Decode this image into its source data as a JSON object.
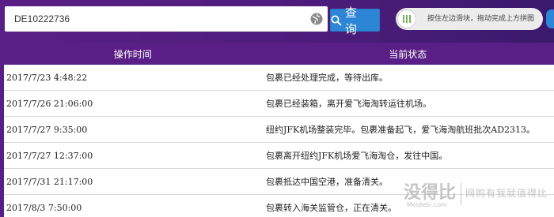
{
  "search": {
    "value": "DE10222736",
    "query_label": "查 询"
  },
  "slider": {
    "hint": "按住左边滑块，拖动完成上方拼图"
  },
  "table": {
    "headers": {
      "time": "操作时间",
      "status": "当前状态"
    },
    "rows": [
      {
        "time": "2017/7/23 4:48:22",
        "status": "包裹已经处理完成，等待出库。"
      },
      {
        "time": "2017/7/26 21:06:00",
        "status": "包裹已经装箱，离开爱飞海淘转运往机场。"
      },
      {
        "time": "2017/7/27 9:35:00",
        "status": "纽约JFK机场整装完毕。包裹准备起飞，爱飞海淘航班批次AD2313。"
      },
      {
        "time": "2017/7/27 12:37:00",
        "status": "包裹离开纽约JFK机场爱飞海淘仓，发往中国。"
      },
      {
        "time": "2017/7/31 21:17:00",
        "status": "包裹抵达中国空港，准备清关。"
      },
      {
        "time": "2017/8/3 7:50:00",
        "status": "包裹转入海关监管仓，正在清关。"
      }
    ]
  },
  "watermark": {
    "logo": "没得比",
    "site": "Meidebi.com",
    "slogan": "网购有我就值得比"
  },
  "colors": {
    "header_purple": "#5a1f86",
    "button_blue": "#2d85d6"
  }
}
